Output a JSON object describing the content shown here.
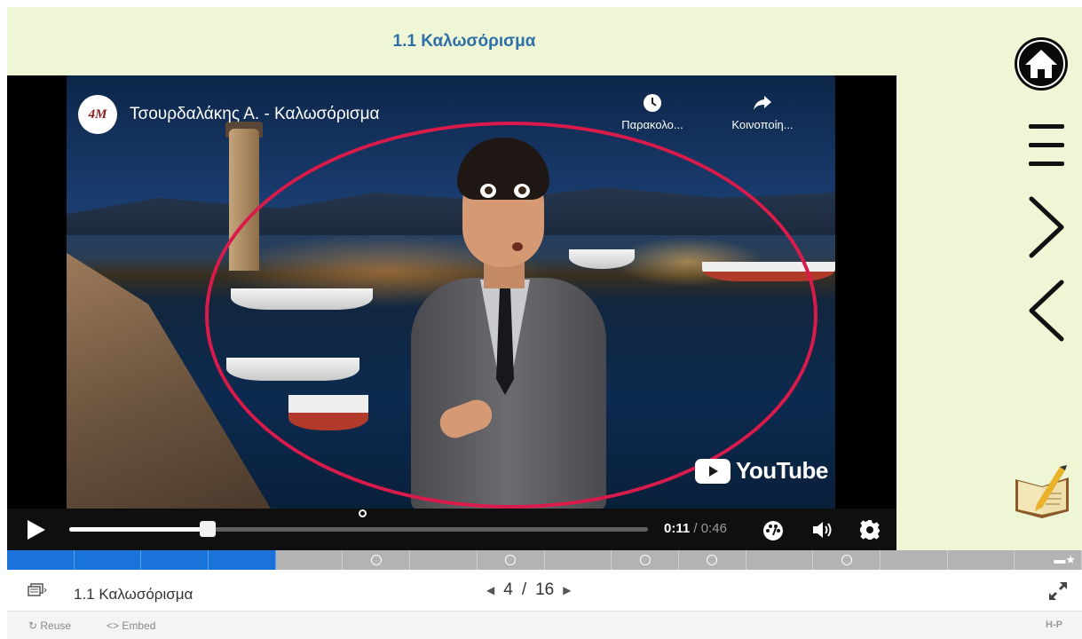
{
  "slide": {
    "title": "1.1 Καλωσόρισμα"
  },
  "video": {
    "channel_badge": "4M",
    "title": "Τσουρδαλάκης Α. - Καλωσόρισμα",
    "watch_later_label": "Παρακολο...",
    "share_label": "Κοινοποίη...",
    "brand": "YouTube",
    "current_time": "0:11",
    "time_separator": " / ",
    "duration": "0:46",
    "progress_fraction": 0.239
  },
  "nav": {
    "home_icon": "home-icon",
    "menu_icon": "menu-icon",
    "next_icon": "chevron-right-icon",
    "prev_icon": "chevron-left-icon",
    "notes_icon": "notebook-icon"
  },
  "progress": {
    "total": 16,
    "completed": 4
  },
  "footer": {
    "title": "1.1 Καλωσόρισμα",
    "current_page": "4",
    "page_separator": "/",
    "total_pages": "16",
    "reuse_label": "Reuse",
    "embed_label": "Embed",
    "h5p_label": "H-P"
  },
  "colors": {
    "slide_bg": "#eef6d6",
    "title_color": "#2f6fa7",
    "progress_done": "#1a73d9",
    "ellipse": "#d81b4a"
  }
}
